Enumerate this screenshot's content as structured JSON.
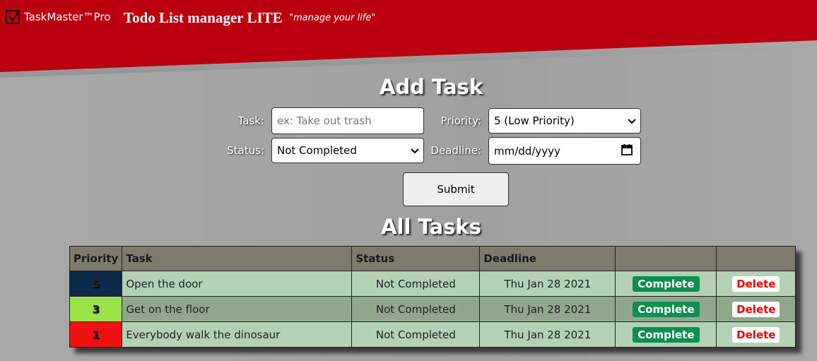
{
  "header": {
    "brand": "TaskMaster™Pro",
    "title": "Todo List manager LITE",
    "tagline": "\"manage your life\"",
    "color": "#bb0010"
  },
  "add_task": {
    "title": "Add Task",
    "task_label": "Task:",
    "task_placeholder": "ex: Take out trash",
    "priority_label": "Priority:",
    "priority_value": "5 (Low Priority)",
    "status_label": "Status:",
    "status_value": "Not Completed",
    "deadline_label": "Deadline:",
    "deadline_value": "mm/dd/yyyy",
    "submit_label": "Submit"
  },
  "all_tasks": {
    "title": "All Tasks",
    "columns": [
      "Priority",
      "Task",
      "Status",
      "Deadline",
      "",
      ""
    ],
    "rows": [
      {
        "priority": "5",
        "priority_color": "#0d2b48",
        "task": "Open the door",
        "status": "Not Completed",
        "deadline": "Thu Jan 28 2021",
        "complete": "Complete",
        "delete": "Delete"
      },
      {
        "priority": "3",
        "priority_color": "#9be24a",
        "task": "Get on the floor",
        "status": "Not Completed",
        "deadline": "Thu Jan 28 2021",
        "complete": "Complete",
        "delete": "Delete"
      },
      {
        "priority": "1",
        "priority_color": "#ee1111",
        "task": "Everybody walk the dinosaur",
        "status": "Not Completed",
        "deadline": "Thu Jan 28 2021",
        "complete": "Complete",
        "delete": "Delete"
      }
    ]
  },
  "icons": {
    "brand_check": "checkbox-check-icon",
    "select_caret": "chevron-down-icon",
    "calendar": "calendar-icon"
  }
}
